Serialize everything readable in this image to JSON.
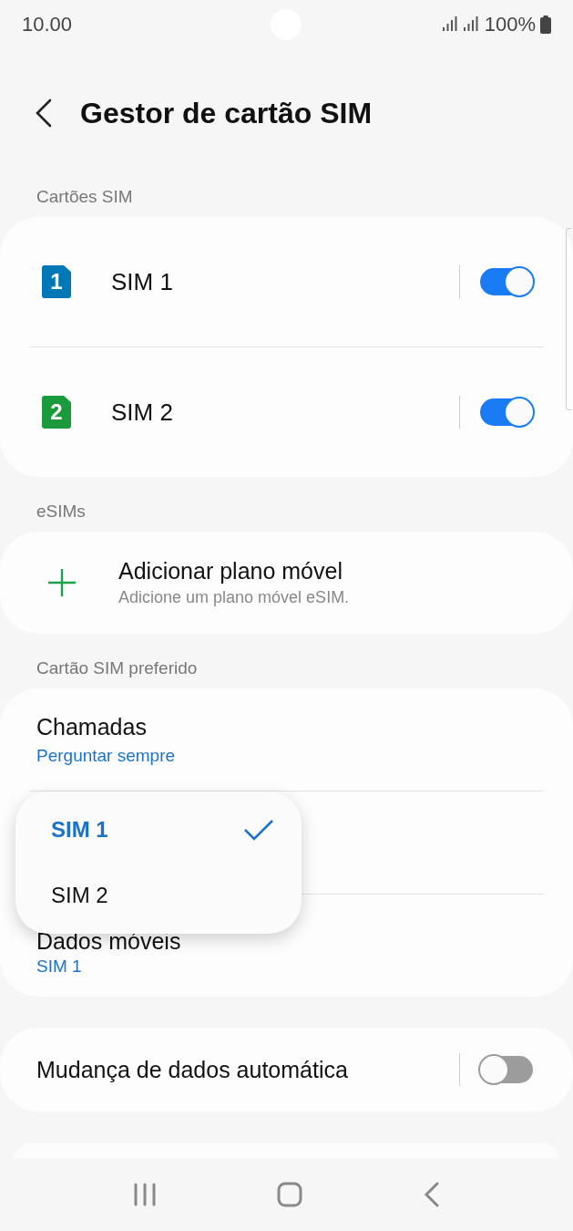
{
  "status_bar": {
    "time": "10.00",
    "battery": "100%"
  },
  "header": {
    "title": "Gestor de cartão SIM"
  },
  "sim_section": {
    "heading": "Cartões SIM",
    "sims": [
      {
        "number": "1",
        "name": "SIM 1",
        "color": "#0077b6",
        "on": true
      },
      {
        "number": "2",
        "name": "SIM 2",
        "color": "#1a9a3a",
        "on": true
      }
    ]
  },
  "esim_section": {
    "heading": "eSIMs",
    "title": "Adicionar plano móvel",
    "subtitle": "Adicione um plano móvel eSIM."
  },
  "preferred_section": {
    "heading": "Cartão SIM preferido",
    "rows": [
      {
        "title": "Chamadas",
        "value": "Perguntar sempre"
      },
      {
        "title": "Dados móveis",
        "value": "SIM 1"
      }
    ]
  },
  "popup_menu": {
    "items": [
      {
        "label": "SIM 1",
        "selected": true
      },
      {
        "label": "SIM 2",
        "selected": false
      }
    ]
  },
  "auto_data": {
    "label": "Mudança de dados automática",
    "on": false
  }
}
